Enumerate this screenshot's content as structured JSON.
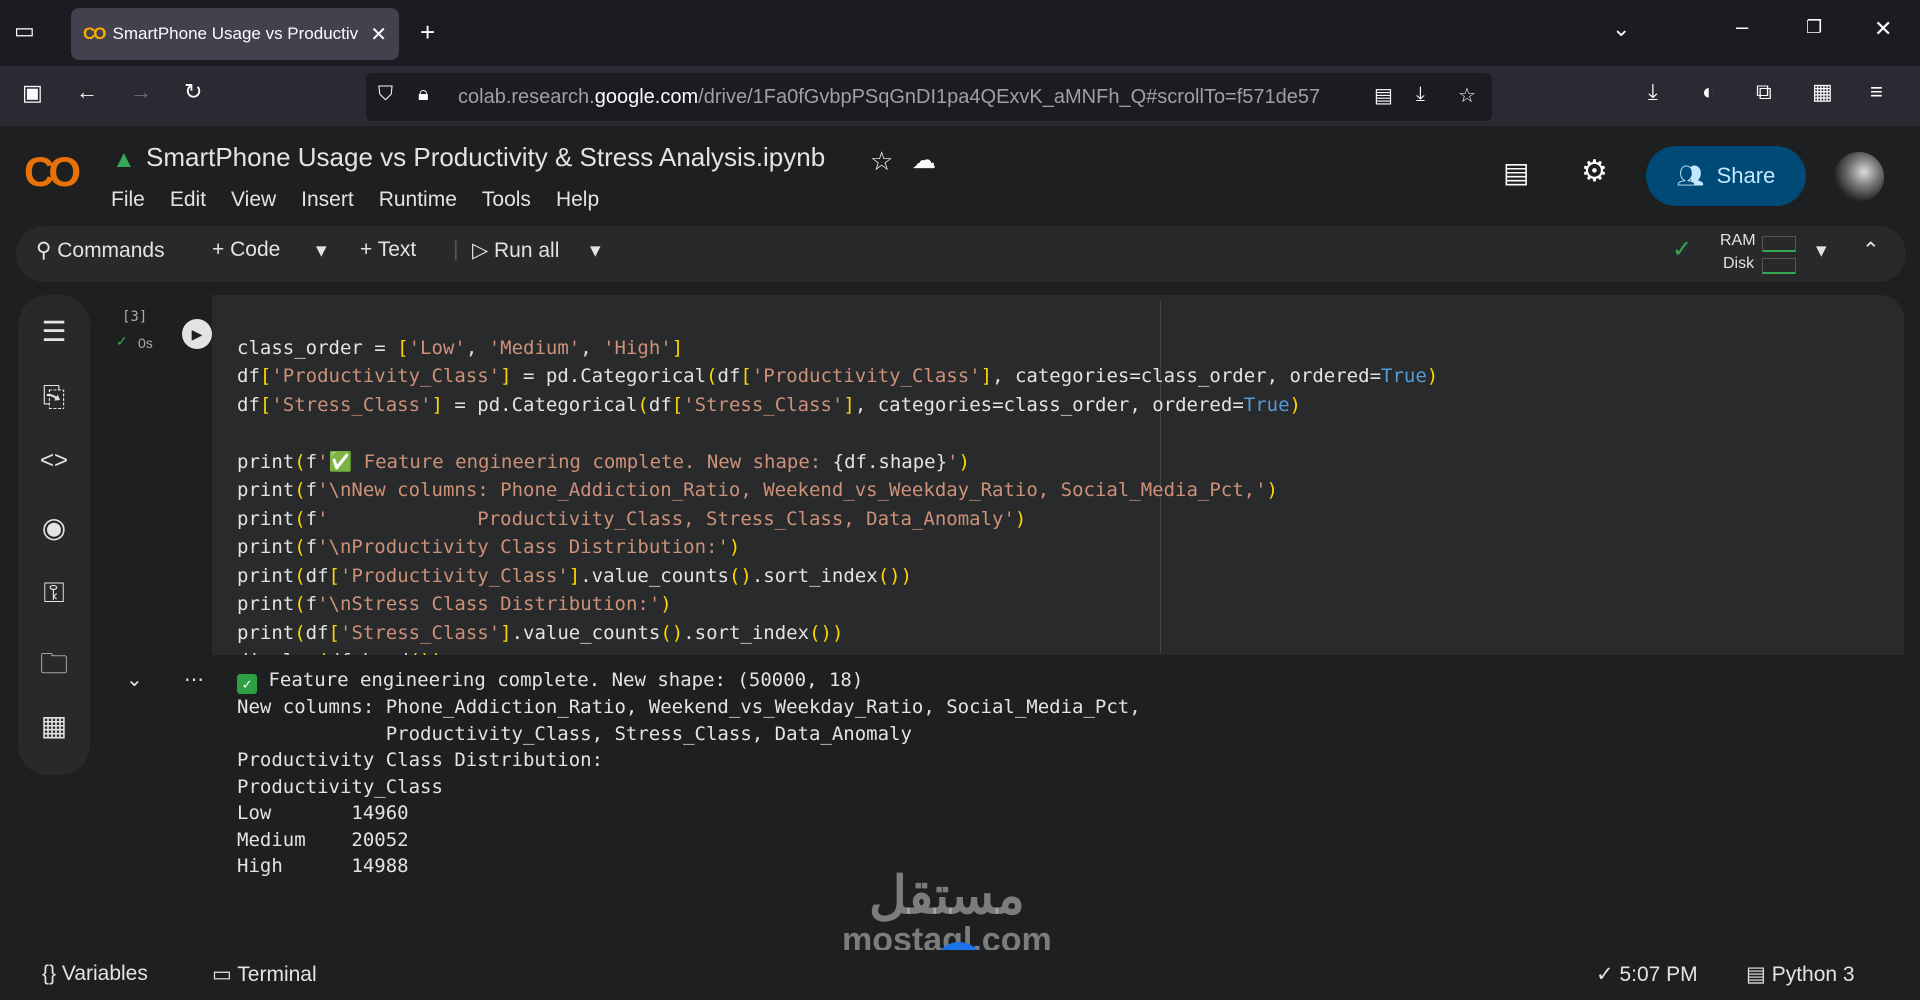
{
  "browser": {
    "tab_title": "SmartPhone Usage vs Productiv",
    "url_prefix": "colab.research.",
    "url_domain": "google.com",
    "url_path": "/drive/1Fa0fGvbpPSqGnDI1pa4QExvK_aMNFh_Q#scrollTo=f571de57"
  },
  "notebook": {
    "title": "SmartPhone Usage vs Productivity & Stress Analysis.ipynb",
    "logo": "CO",
    "share_label": "Share"
  },
  "menu": [
    "File",
    "Edit",
    "View",
    "Insert",
    "Runtime",
    "Tools",
    "Help"
  ],
  "toolbar": {
    "commands": "Commands",
    "code": "+ Code",
    "text": "+ Text",
    "run_all": "Run all",
    "ram": "RAM",
    "disk": "Disk"
  },
  "cell": {
    "exec_count": "[3]",
    "exec_time": "0s",
    "code_lines": [
      "class_order = ['Low', 'Medium', 'High']",
      "df['Productivity_Class'] = pd.Categorical(df['Productivity_Class'], categories=class_order, ordered=True)",
      "df['Stress_Class'] = pd.Categorical(df['Stress_Class'], categories=class_order, ordered=True)",
      "",
      "print(f'✅ Feature engineering complete. New shape: {df.shape}')",
      "print(f'\\nNew columns: Phone_Addiction_Ratio, Weekend_vs_Weekday_Ratio, Social_Media_Pct,')",
      "print(f'             Productivity_Class, Stress_Class, Data_Anomaly')",
      "print(f'\\nProductivity Class Distribution:')",
      "print(df['Productivity_Class'].value_counts().sort_index())",
      "print(f'\\nStress Class Distribution:')",
      "print(df['Stress_Class'].value_counts().sort_index())",
      "display(df.head())"
    ],
    "output_first": " Feature engineering complete. New shape: (50000, 18)",
    "output_lines": [
      "",
      "New columns: Phone_Addiction_Ratio, Weekend_vs_Weekday_Ratio, Social_Media_Pct,",
      "             Productivity_Class, Stress_Class, Data_Anomaly",
      "",
      "Productivity Class Distribution:",
      "Productivity_Class",
      "Low       14960",
      "Medium    20052",
      "High      14988"
    ]
  },
  "statusbar": {
    "variables": "Variables",
    "terminal": "Terminal",
    "time": "5:07 PM",
    "kernel": "Python 3"
  },
  "watermark": {
    "arabic": "مستقل",
    "latin": "mostaql.com"
  },
  "colors": {
    "accent": "#f9ab00",
    "share_bg": "#004a77",
    "check": "#2ea043"
  }
}
